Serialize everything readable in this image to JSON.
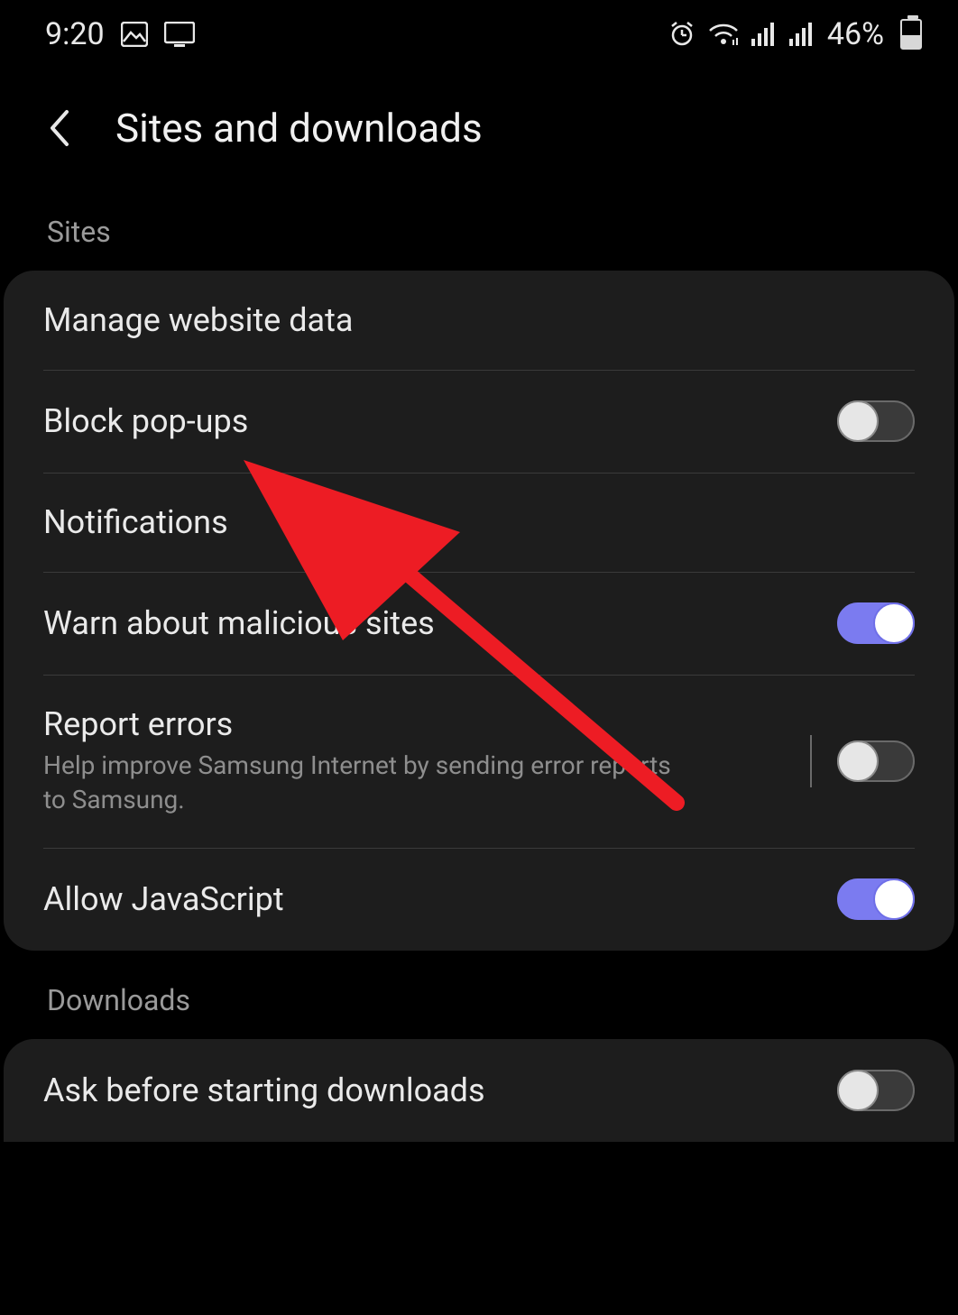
{
  "status": {
    "time": "9:20",
    "battery_percent": "46%",
    "battery_fill_pct": 46
  },
  "header": {
    "title": "Sites and downloads"
  },
  "sections": {
    "sites": {
      "label": "Sites",
      "rows": {
        "manage": {
          "title": "Manage website data"
        },
        "popups": {
          "title": "Block pop-ups",
          "on": false
        },
        "notifications": {
          "title": "Notifications"
        },
        "warn": {
          "title": "Warn about malicious sites",
          "on": true
        },
        "report": {
          "title": "Report errors",
          "sub": "Help improve Samsung Internet by sending error reports to Samsung.",
          "on": false
        },
        "js": {
          "title": "Allow JavaScript",
          "on": true
        }
      }
    },
    "downloads": {
      "label": "Downloads",
      "rows": {
        "ask": {
          "title": "Ask before starting downloads",
          "on": false
        }
      }
    }
  }
}
